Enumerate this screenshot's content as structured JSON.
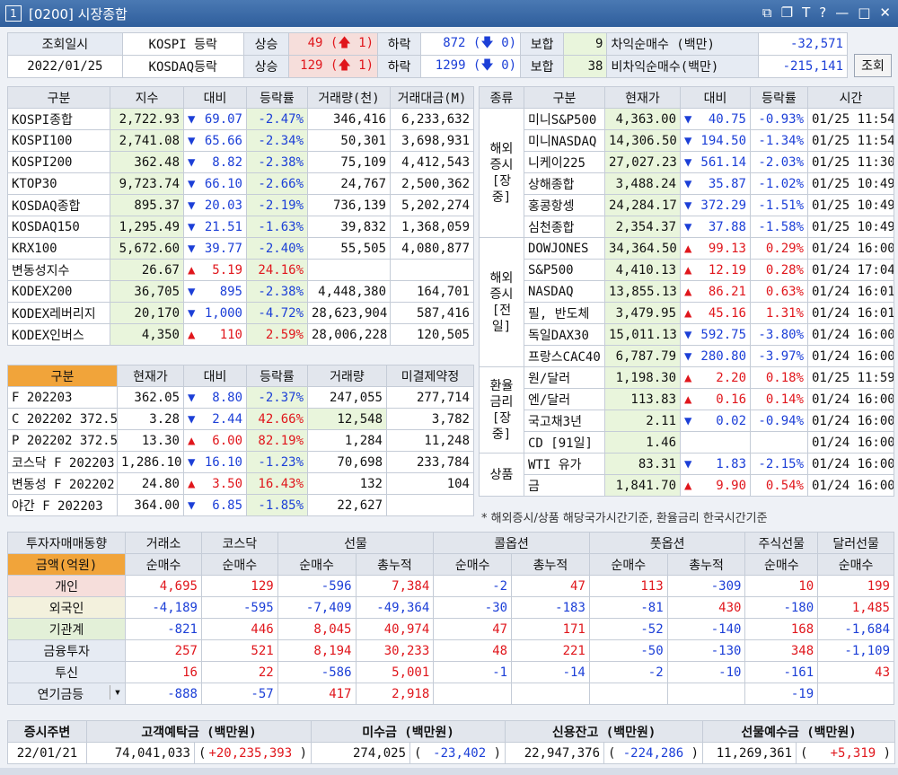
{
  "window": {
    "number": "1",
    "title": "[0200] 시장종합",
    "icons": [
      "layout-icon",
      "window-icon",
      "font-icon",
      "help-icon",
      "minimize-icon",
      "maximize-icon",
      "close-icon"
    ]
  },
  "header": {
    "date_label": "조회일시",
    "date_value": "2022/01/25",
    "kospi_label": "KOSPI 등락",
    "kosdaq_label": "KOSDAQ등락",
    "rise": "상승",
    "fall": "하락",
    "flat": "보합",
    "kospi_up": "49",
    "kospi_up_limit": "1",
    "kospi_dn": "872",
    "kospi_dn_limit": "0",
    "kospi_flat": "9",
    "kosdaq_up": "129",
    "kosdaq_up_limit": "1",
    "kosdaq_dn": "1299",
    "kosdaq_dn_limit": "0",
    "kosdaq_flat": "38",
    "arb_label": "차익순매수  (백만)",
    "arb_value": "-32,571",
    "nonarb_label": "비차익순매수(백만)",
    "nonarb_value": "-215,141",
    "query_button": "조회"
  },
  "index_table": {
    "headers": [
      "구분",
      "지수",
      "대비",
      "등락률",
      "거래량(천)",
      "거래대금(M)"
    ],
    "rows": [
      {
        "name": "KOSPI종합",
        "val": "2,722.93",
        "dir": "dn",
        "chg": "69.07",
        "rate": "-2.47%",
        "vol": "346,416",
        "amt": "6,233,632"
      },
      {
        "name": "KOSPI100",
        "val": "2,741.08",
        "dir": "dn",
        "chg": "65.66",
        "rate": "-2.34%",
        "vol": "50,301",
        "amt": "3,698,931"
      },
      {
        "name": "KOSPI200",
        "val": "362.48",
        "dir": "dn",
        "chg": "8.82",
        "rate": "-2.38%",
        "vol": "75,109",
        "amt": "4,412,543"
      },
      {
        "name": "KTOP30",
        "val": "9,723.74",
        "dir": "dn",
        "chg": "66.10",
        "rate": "-2.66%",
        "vol": "24,767",
        "amt": "2,500,362"
      },
      {
        "name": "KOSDAQ종합",
        "val": "895.37",
        "dir": "dn",
        "chg": "20.03",
        "rate": "-2.19%",
        "vol": "736,139",
        "amt": "5,202,274"
      },
      {
        "name": "KOSDAQ150",
        "val": "1,295.49",
        "dir": "dn",
        "chg": "21.51",
        "rate": "-1.63%",
        "vol": "39,832",
        "amt": "1,368,059"
      },
      {
        "name": "KRX100",
        "val": "5,672.60",
        "dir": "dn",
        "chg": "39.77",
        "rate": "-2.40%",
        "vol": "55,505",
        "amt": "4,080,877"
      },
      {
        "name": "변동성지수",
        "val": "26.67",
        "dir": "up",
        "chg": "5.19",
        "rate": "24.16%",
        "vol": "",
        "amt": ""
      },
      {
        "name": "KODEX200",
        "val": "36,705",
        "dir": "dn",
        "chg": "895",
        "rate": "-2.38%",
        "vol": "4,448,380",
        "amt": "164,701"
      },
      {
        "name": "KODEX레버리지",
        "val": "20,170",
        "dir": "dn",
        "chg": "1,000",
        "rate": "-4.72%",
        "vol": "28,623,904",
        "amt": "587,416"
      },
      {
        "name": "KODEX인버스",
        "val": "4,350",
        "dir": "up",
        "chg": "110",
        "rate": "2.59%",
        "vol": "28,006,228",
        "amt": "120,505"
      }
    ]
  },
  "futures_table": {
    "headers": [
      "구분",
      "현재가",
      "대비",
      "등락률",
      "거래량",
      "미결제약정"
    ],
    "rows": [
      {
        "name": "F 202203",
        "val": "362.05",
        "dir": "dn",
        "chg": "8.80",
        "rate": "-2.37%",
        "vol": "247,055",
        "oi": "277,714"
      },
      {
        "name": "C 202202 372.5",
        "val": "3.28",
        "dir": "dn",
        "chg": "2.44",
        "rate": "42.66%",
        "vol": "12,548",
        "oi": "3,782"
      },
      {
        "name": "P 202202 372.5",
        "val": "13.30",
        "dir": "up",
        "chg": "6.00",
        "rate": "82.19%",
        "vol": "1,284",
        "oi": "11,248"
      },
      {
        "name": "코스닥 F 202203",
        "val": "1,286.10",
        "dir": "dn",
        "chg": "16.10",
        "rate": "-1.23%",
        "vol": "70,698",
        "oi": "233,784"
      },
      {
        "name": "변동성 F 202202",
        "val": "24.80",
        "dir": "up",
        "chg": "3.50",
        "rate": "16.43%",
        "vol": "132",
        "oi": "104"
      },
      {
        "name": "야간 F 202203",
        "val": "364.00",
        "dir": "dn",
        "chg": "6.85",
        "rate": "-1.85%",
        "vol": "22,627",
        "oi": ""
      }
    ]
  },
  "world_table": {
    "headers": [
      "종류",
      "구분",
      "현재가",
      "대비",
      "등락률",
      "시간"
    ],
    "groups": [
      {
        "label": "해외\n증시\n[장중]",
        "rows": [
          {
            "name": "미니S&P500",
            "val": "4,363.00",
            "dir": "dn",
            "chg": "40.75",
            "rate": "-0.93%",
            "time": "01/25 11:54"
          },
          {
            "name": "미니NASDAQ",
            "val": "14,306.50",
            "dir": "dn",
            "chg": "194.50",
            "rate": "-1.34%",
            "time": "01/25 11:54"
          },
          {
            "name": "니케이225",
            "val": "27,027.23",
            "dir": "dn",
            "chg": "561.14",
            "rate": "-2.03%",
            "time": "01/25 11:30"
          },
          {
            "name": "상해종합",
            "val": "3,488.24",
            "dir": "dn",
            "chg": "35.87",
            "rate": "-1.02%",
            "time": "01/25 10:49"
          },
          {
            "name": "홍콩항셍",
            "val": "24,284.17",
            "dir": "dn",
            "chg": "372.29",
            "rate": "-1.51%",
            "time": "01/25 10:49"
          },
          {
            "name": "심천종합",
            "val": "2,354.37",
            "dir": "dn",
            "chg": "37.88",
            "rate": "-1.58%",
            "time": "01/25 10:49"
          }
        ]
      },
      {
        "label": "해외\n증시\n[전일]",
        "rows": [
          {
            "name": "DOWJONES",
            "val": "34,364.50",
            "dir": "up",
            "chg": "99.13",
            "rate": "0.29%",
            "time": "01/24 16:00"
          },
          {
            "name": "S&P500",
            "val": "4,410.13",
            "dir": "up",
            "chg": "12.19",
            "rate": "0.28%",
            "time": "01/24 17:04"
          },
          {
            "name": "NASDAQ",
            "val": "13,855.13",
            "dir": "up",
            "chg": "86.21",
            "rate": "0.63%",
            "time": "01/24 16:01"
          },
          {
            "name": "필, 반도체",
            "val": "3,479.95",
            "dir": "up",
            "chg": "45.16",
            "rate": "1.31%",
            "time": "01/24 16:01"
          },
          {
            "name": "독일DAX30",
            "val": "15,011.13",
            "dir": "dn",
            "chg": "592.75",
            "rate": "-3.80%",
            "time": "01/24 16:00"
          },
          {
            "name": "프랑스CAC40",
            "val": "6,787.79",
            "dir": "dn",
            "chg": "280.80",
            "rate": "-3.97%",
            "time": "01/24 16:00"
          }
        ]
      },
      {
        "label": "환율\n금리\n[장중]",
        "rows": [
          {
            "name": "원/달러",
            "val": "1,198.30",
            "dir": "up",
            "chg": "2.20",
            "rate": "0.18%",
            "time": "01/25 11:59"
          },
          {
            "name": "엔/달러",
            "val": "113.83",
            "dir": "up",
            "chg": "0.16",
            "rate": "0.14%",
            "time": "01/24 16:00"
          },
          {
            "name": "국고채3년",
            "val": "2.11",
            "dir": "dn",
            "chg": "0.02",
            "rate": "-0.94%",
            "time": "01/24 16:00"
          },
          {
            "name": "CD [91일]",
            "val": "1.46",
            "dir": "",
            "chg": "",
            "rate": "",
            "time": "01/24 16:00"
          }
        ]
      },
      {
        "label": "상품",
        "rows": [
          {
            "name": "WTI 유가",
            "val": "83.31",
            "dir": "dn",
            "chg": "1.83",
            "rate": "-2.15%",
            "time": "01/24 16:00"
          },
          {
            "name": "금",
            "val": "1,841.70",
            "dir": "up",
            "chg": "9.90",
            "rate": "0.54%",
            "time": "01/24 16:00"
          }
        ]
      }
    ],
    "note": "* 해외증시/상품 해당국가시간기준, 환율금리 한국시간기준"
  },
  "investor_table": {
    "title": "투자자매매동향",
    "amount_label": "금액(억원)",
    "groups": [
      "거래소",
      "코스닥",
      "선물",
      "콜옵션",
      "풋옵션",
      "주식선물",
      "달러선물"
    ],
    "subheaders": [
      "순매수",
      "순매수",
      "순매수",
      "총누적",
      "순매수",
      "총누적",
      "순매수",
      "총누적",
      "순매수",
      "순매수"
    ],
    "rows": [
      {
        "name": "개인",
        "vals": [
          "4,695",
          "129",
          "-596",
          "7,384",
          "-2",
          "47",
          "113",
          "-309",
          "10",
          "199"
        ]
      },
      {
        "name": "외국인",
        "vals": [
          "-4,189",
          "-595",
          "-7,409",
          "-49,364",
          "-30",
          "-183",
          "-81",
          "430",
          "-180",
          "1,485"
        ]
      },
      {
        "name": "기관계",
        "vals": [
          "-821",
          "446",
          "8,045",
          "40,974",
          "47",
          "171",
          "-52",
          "-140",
          "168",
          "-1,684"
        ]
      },
      {
        "name": "금융투자",
        "vals": [
          "257",
          "521",
          "8,194",
          "30,233",
          "48",
          "221",
          "-50",
          "-130",
          "348",
          "-1,109"
        ]
      },
      {
        "name": "투신",
        "vals": [
          "16",
          "22",
          "-586",
          "5,001",
          "-1",
          "-14",
          "-2",
          "-10",
          "-161",
          "43"
        ]
      },
      {
        "name": "연기금등",
        "vals": [
          "-888",
          "-57",
          "417",
          "2,918",
          "",
          "",
          "",
          "",
          "-19",
          ""
        ]
      }
    ]
  },
  "deposit_table": {
    "headers": [
      "증시주변",
      "고객예탁금 (백만원)",
      "미수금 (백만원)",
      "신용잔고 (백만원)",
      "선물예수금 (백만원)"
    ],
    "date": "22/01/21",
    "cust": "74,041,033",
    "cust_chg": "+20,235,393",
    "unpaid": "274,025",
    "unpaid_chg": "-23,402",
    "credit": "22,947,376",
    "credit_chg": "-224,286",
    "fut": "11,269,361",
    "fut_chg": "+5,319"
  },
  "colors": {
    "up": "#e0161c",
    "down": "#1c3fd7",
    "title": "#3a6aa8",
    "orange": "#f1a43a"
  }
}
